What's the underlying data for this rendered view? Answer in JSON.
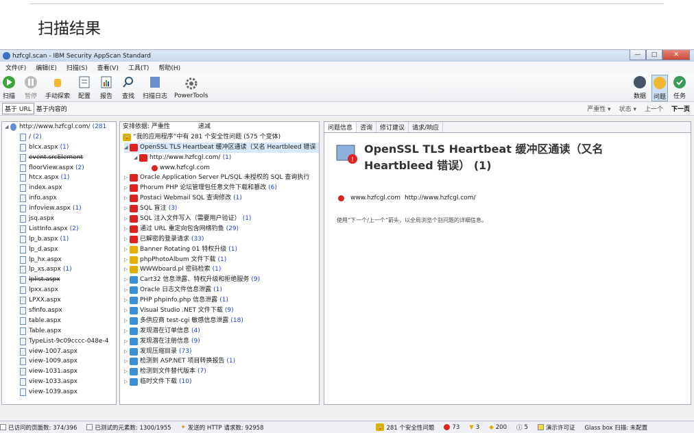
{
  "doc": {
    "heading": "扫描结果"
  },
  "window": {
    "title": "hzfcgl.scan - IBM Security AppScan Standard"
  },
  "menu": [
    "文件(F)",
    "编辑(E)",
    "扫描(S)",
    "查看(V)",
    "工具(T)",
    "帮助(H)"
  ],
  "toolbar": {
    "scan": "扫描",
    "pause": "暂停",
    "manual": "手动探索",
    "config": "配置",
    "report": "报告",
    "find": "查找",
    "log": "扫描日志",
    "powertools": "PowerTools",
    "data": "数据",
    "issues": "问题",
    "tasks": "任务"
  },
  "viewbar": {
    "by_url": "基于 URL",
    "by_content": "基于内容的",
    "severity": "严重性 ▾",
    "status": "状态 ▾",
    "prev": "上一个",
    "next": "下一页"
  },
  "urltree": {
    "root": "http://www.hzfcgl.com/",
    "root_count": "(281",
    "items": [
      {
        "name": "/",
        "count": "(2)",
        "strike": false
      },
      {
        "name": "blcx.aspx",
        "count": "(1)",
        "strike": false
      },
      {
        "name": "event.srcElement",
        "count": "",
        "strike": true
      },
      {
        "name": "floorView.aspx",
        "count": "(2)",
        "strike": false
      },
      {
        "name": "htcx.aspx",
        "count": "(1)",
        "strike": false
      },
      {
        "name": "index.aspx",
        "count": "",
        "strike": false
      },
      {
        "name": "info.aspx",
        "count": "",
        "strike": false
      },
      {
        "name": "infoview.aspx",
        "count": "(1)",
        "strike": false
      },
      {
        "name": "jsq.aspx",
        "count": "",
        "strike": false
      },
      {
        "name": "ListInfo.aspx",
        "count": "(2)",
        "strike": false
      },
      {
        "name": "lp_b.aspx",
        "count": "(1)",
        "strike": false
      },
      {
        "name": "lp_d.aspx",
        "count": "",
        "strike": false
      },
      {
        "name": "lp_hx.aspx",
        "count": "",
        "strike": false
      },
      {
        "name": "lp_xs.aspx",
        "count": "(1)",
        "strike": false
      },
      {
        "name": "lplist.aspx",
        "count": "",
        "strike": true
      },
      {
        "name": "lpxx.aspx",
        "count": "",
        "strike": false
      },
      {
        "name": "LPXX.aspx",
        "count": "",
        "strike": false
      },
      {
        "name": "sfinfo.aspx",
        "count": "",
        "strike": false
      },
      {
        "name": "table.aspx",
        "count": "",
        "strike": false
      },
      {
        "name": "Table.aspx",
        "count": "",
        "strike": false
      },
      {
        "name": "TypeList-9c09cccc-048e-4",
        "count": "",
        "strike": false
      },
      {
        "name": "view-1007.aspx",
        "count": "",
        "strike": false
      },
      {
        "name": "view-1009.aspx",
        "count": "",
        "strike": false
      },
      {
        "name": "view-1031.aspx",
        "count": "",
        "strike": false
      },
      {
        "name": "view-1033.aspx",
        "count": "",
        "strike": false
      },
      {
        "name": "view-1039.aspx",
        "count": "",
        "strike": false
      }
    ]
  },
  "issues": {
    "header_col1": "安排依据: 严重性",
    "header_col2": "递减",
    "summary": "“我的应用程序”中有 281 个安全性问题 (575 个变体)",
    "selected_child": "http://www.hzfcgl.com/",
    "selected_child_count": "(1)",
    "selected_grandchild": "www.hzfcgl.com",
    "items": [
      {
        "name": "OpenSSL TLS Heartbeat 缓冲区通读（又名 Heartbleed 错误",
        "count": "",
        "sev": "h"
      },
      {
        "name": "Oracle Application Server PL/SQL 未授权的 SQL 查询执行",
        "count": "",
        "sev": "h"
      },
      {
        "name": "Phorum PHP 论坛管理包任意文件下载和篡改",
        "count": "(6)",
        "sev": "h"
      },
      {
        "name": "Postaci Webmail SQL 查询修改",
        "count": "(1)",
        "sev": "h"
      },
      {
        "name": "SQL 盲注",
        "count": "(3)",
        "sev": "h"
      },
      {
        "name": "SQL 注入文件写入（需要用户验证）",
        "count": "(1)",
        "sev": "h"
      },
      {
        "name": "通过 URL 重定向包含网络钓鱼",
        "count": "(29)",
        "sev": "h"
      },
      {
        "name": "已解密的登录请求",
        "count": "(33)",
        "sev": "h"
      },
      {
        "name": "Banner Rotating 01 特权升级",
        "count": "(1)",
        "sev": "m"
      },
      {
        "name": "phpPhotoAlbum 文件下载",
        "count": "(1)",
        "sev": "m"
      },
      {
        "name": "WWWboard.pl 密码检索",
        "count": "(1)",
        "sev": "m"
      },
      {
        "name": "Cart32 信息泄露、特权升级和拒绝服务",
        "count": "(9)",
        "sev": "l"
      },
      {
        "name": "Oracle 日志文件信息泄露",
        "count": "(1)",
        "sev": "l"
      },
      {
        "name": "PHP phpinfo.php 信息泄露",
        "count": "(1)",
        "sev": "l"
      },
      {
        "name": "Visual Studio .NET 文件下载",
        "count": "(9)",
        "sev": "l"
      },
      {
        "name": "多供应商 test-cgi 敏感信息泄露",
        "count": "(18)",
        "sev": "l"
      },
      {
        "name": "发现潜在订单信息",
        "count": "(4)",
        "sev": "l"
      },
      {
        "name": "发现潜在注册信息",
        "count": "(9)",
        "sev": "l"
      },
      {
        "name": "发现压缩目录",
        "count": "(73)",
        "sev": "l"
      },
      {
        "name": "检测到 ASP.NET 项目转换报告",
        "count": "(1)",
        "sev": "l"
      },
      {
        "name": "检测到文件替代版本",
        "count": "(7)",
        "sev": "l"
      },
      {
        "name": "临时文件下载",
        "count": "(10)",
        "sev": "l"
      }
    ]
  },
  "detail": {
    "tabs": [
      "问题信息",
      "咨询",
      "修订建议",
      "请求/响应"
    ],
    "title": "OpenSSL TLS Heartbeat 缓冲区通读（又名 Heartbleed 错误） (1)",
    "host": "www.hzfcgl.com",
    "url": "http://www.hzfcgl.com/",
    "hint": "使用“下一个/上一个”箭头，以全局浏览个别问题的详细信息。"
  },
  "status": {
    "visited": "已访问的页面数: 374/396",
    "tested": "已测试的元素数: 1300/1955",
    "requests": "发送的 HTTP 请求数: 92958",
    "issues": "281 个安全性问题",
    "high": "73",
    "med": "3",
    "low": "200",
    "info": "5",
    "license": "演示许可证",
    "glassbox": "Glass box 扫描: 未配置"
  },
  "colors": {
    "accent": "#2244cc",
    "high": "#dd2222",
    "medium": "#e0b000"
  }
}
